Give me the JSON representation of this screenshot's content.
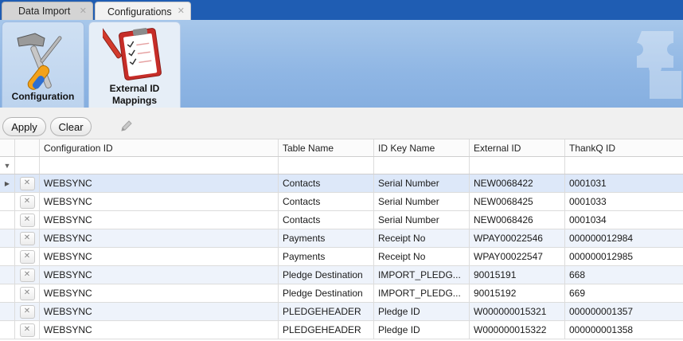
{
  "tabs": [
    {
      "label": "Data Import",
      "close": "✕"
    },
    {
      "label": "Configurations",
      "close": "✕"
    }
  ],
  "ribbon": {
    "configuration_label": "Configuration",
    "mapping_label_line1": "External ID",
    "mapping_label_line2": "Mappings"
  },
  "toolbar": {
    "apply_label": "Apply",
    "clear_label": "Clear"
  },
  "grid": {
    "columns": [
      "Configuration ID",
      "Table Name",
      "ID Key Name",
      "External ID",
      "ThankQ ID"
    ],
    "rows": [
      {
        "config_id": "WEBSYNC",
        "table_name": "Contacts",
        "id_key_name": "Serial Number",
        "external_id": "NEW0068422",
        "thankq_id": "0001031"
      },
      {
        "config_id": "WEBSYNC",
        "table_name": "Contacts",
        "id_key_name": "Serial Number",
        "external_id": "NEW0068425",
        "thankq_id": "0001033"
      },
      {
        "config_id": "WEBSYNC",
        "table_name": "Contacts",
        "id_key_name": "Serial Number",
        "external_id": "NEW0068426",
        "thankq_id": "0001034"
      },
      {
        "config_id": "WEBSYNC",
        "table_name": "Payments",
        "id_key_name": "Receipt No",
        "external_id": "WPAY00022546",
        "thankq_id": "000000012984"
      },
      {
        "config_id": "WEBSYNC",
        "table_name": "Payments",
        "id_key_name": "Receipt No",
        "external_id": "WPAY00022547",
        "thankq_id": "000000012985"
      },
      {
        "config_id": "WEBSYNC",
        "table_name": "Pledge Destination",
        "id_key_name": "IMPORT_PLEDG...",
        "external_id": "90015191",
        "thankq_id": "668"
      },
      {
        "config_id": "WEBSYNC",
        "table_name": "Pledge Destination",
        "id_key_name": "IMPORT_PLEDG...",
        "external_id": "90015192",
        "thankq_id": "669"
      },
      {
        "config_id": "WEBSYNC",
        "table_name": "PLEDGEHEADER",
        "id_key_name": "Pledge ID",
        "external_id": "W000000015321",
        "thankq_id": "000000001357"
      },
      {
        "config_id": "WEBSYNC",
        "table_name": "PLEDGEHEADER",
        "id_key_name": "Pledge ID",
        "external_id": "W000000015322",
        "thankq_id": "000000001358"
      }
    ]
  },
  "icons": {
    "tab_close": "close-icon",
    "configuration": "hammer-screwdriver-icon",
    "mapping": "clipboard-checklist-icon",
    "edit": "pencil-icon",
    "filter": "filter-icon",
    "row_indicator": "row-pointer-icon",
    "row_delete": "delete-icon"
  },
  "colors": {
    "tabstrip": "#1f5db3",
    "ribbon": "#8fb6e4",
    "selected_row": "#dde8f9",
    "alt_row": "#eef3fb"
  }
}
